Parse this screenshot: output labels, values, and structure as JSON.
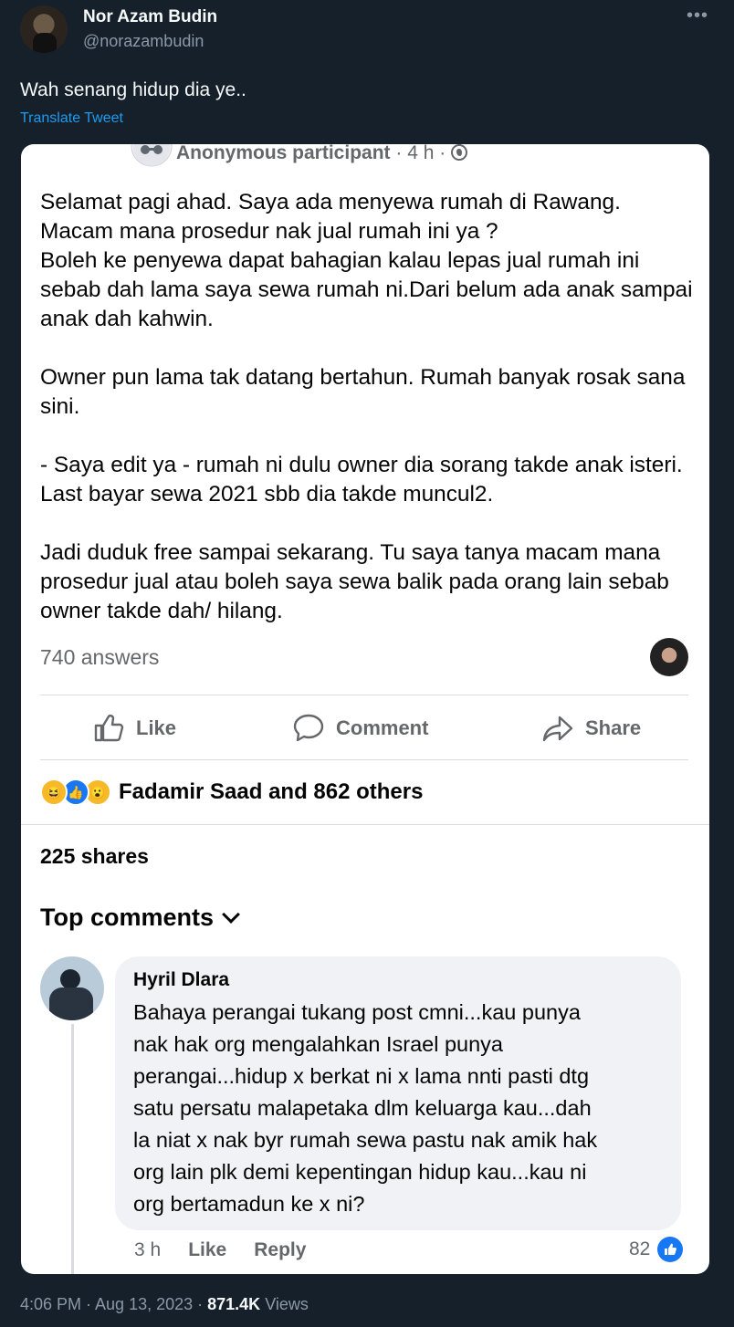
{
  "tweet": {
    "author_name": "Nor Azam Budin",
    "author_handle": "@norazambudin",
    "more_icon": "more-horizontal-icon",
    "text": "Wah senang hidup dia ye..",
    "translate_label": "Translate Tweet",
    "timestamp": "4:06 PM · Aug 13, 2023 · ",
    "views_count": "871.4K",
    "views_label": " Views"
  },
  "post": {
    "author": "Anonymous participant",
    "time": " · 4 h · ",
    "paragraphs": [
      "Selamat pagi ahad. Saya ada menyewa rumah di Rawang.\nMacam mana prosedur nak jual rumah ini ya ?\nBoleh ke penyewa dapat bahagian kalau lepas jual rumah ini sebab dah lama saya sewa rumah ni.Dari belum ada anak sampai anak dah kahwin.",
      "Owner pun lama tak datang bertahun. Rumah banyak rosak sana sini.",
      "- Saya edit ya - rumah ni dulu owner dia sorang takde anak isteri. Last bayar sewa 2021 sbb dia takde muncul2.",
      "Jadi duduk free sampai sekarang. Tu saya tanya macam mana prosedur jual atau boleh saya sewa balik pada orang lain sebab owner takde dah/ hilang."
    ],
    "answers": "740 answers",
    "actions": {
      "like": "Like",
      "comment": "Comment",
      "share": "Share"
    },
    "reactions_text": "Fadamir Saad and 862 others",
    "shares": "225 shares",
    "top_comments_label": "Top comments"
  },
  "comment": {
    "name": "Hyril Dlara",
    "text": "Bahaya perangai tukang post cmni...kau punya\nnak hak org mengalahkan Israel punya\nperangai...hidup x berkat ni x lama nnti pasti dtg\nsatu persatu malapetaka dlm keluarga kau...dah\nla niat x nak byr rumah sewa pastu nak amik hak\norg lain plk demi kepentingan hidup kau...kau ni\norg bertamadun ke x ni?",
    "time": "3 h",
    "like": "Like",
    "reply": "Reply",
    "likes_count": "82"
  },
  "colors": {
    "background": "#15202b",
    "link_blue": "#1d9bf0",
    "facebook_blue": "#1877f2",
    "muted": "#65676b"
  }
}
